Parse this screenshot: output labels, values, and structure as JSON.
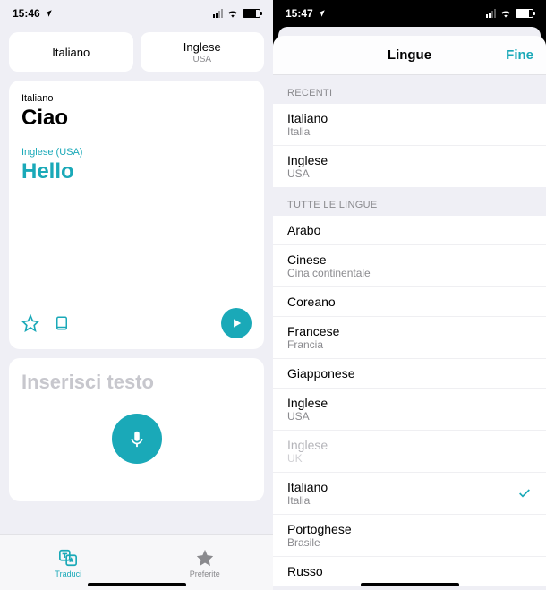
{
  "left": {
    "statusbar": {
      "time": "15:46"
    },
    "lang_source": {
      "label": "Italiano",
      "sub": ""
    },
    "lang_target": {
      "label": "Inglese",
      "sub": "USA"
    },
    "translation": {
      "src_label": "Italiano",
      "src_text": "Ciao",
      "dst_label": "Inglese (USA)",
      "dst_text": "Hello"
    },
    "input_placeholder": "Inserisci testo",
    "tabs": {
      "translate": "Traduci",
      "favorites": "Preferite"
    }
  },
  "right": {
    "statusbar": {
      "time": "15:47"
    },
    "sheet": {
      "title": "Lingue",
      "done": "Fine",
      "sections": {
        "recent_header": "RECENTI",
        "all_header": "TUTTE LE LINGUE"
      },
      "recent": [
        {
          "title": "Italiano",
          "sub": "Italia"
        },
        {
          "title": "Inglese",
          "sub": "USA"
        }
      ],
      "all": [
        {
          "title": "Arabo",
          "sub": ""
        },
        {
          "title": "Cinese",
          "sub": "Cina continentale"
        },
        {
          "title": "Coreano",
          "sub": ""
        },
        {
          "title": "Francese",
          "sub": "Francia"
        },
        {
          "title": "Giapponese",
          "sub": ""
        },
        {
          "title": "Inglese",
          "sub": "USA"
        },
        {
          "title": "Inglese",
          "sub": "UK",
          "dim": true
        },
        {
          "title": "Italiano",
          "sub": "Italia",
          "checked": true
        },
        {
          "title": "Portoghese",
          "sub": "Brasile"
        },
        {
          "title": "Russo",
          "sub": ""
        }
      ]
    }
  }
}
